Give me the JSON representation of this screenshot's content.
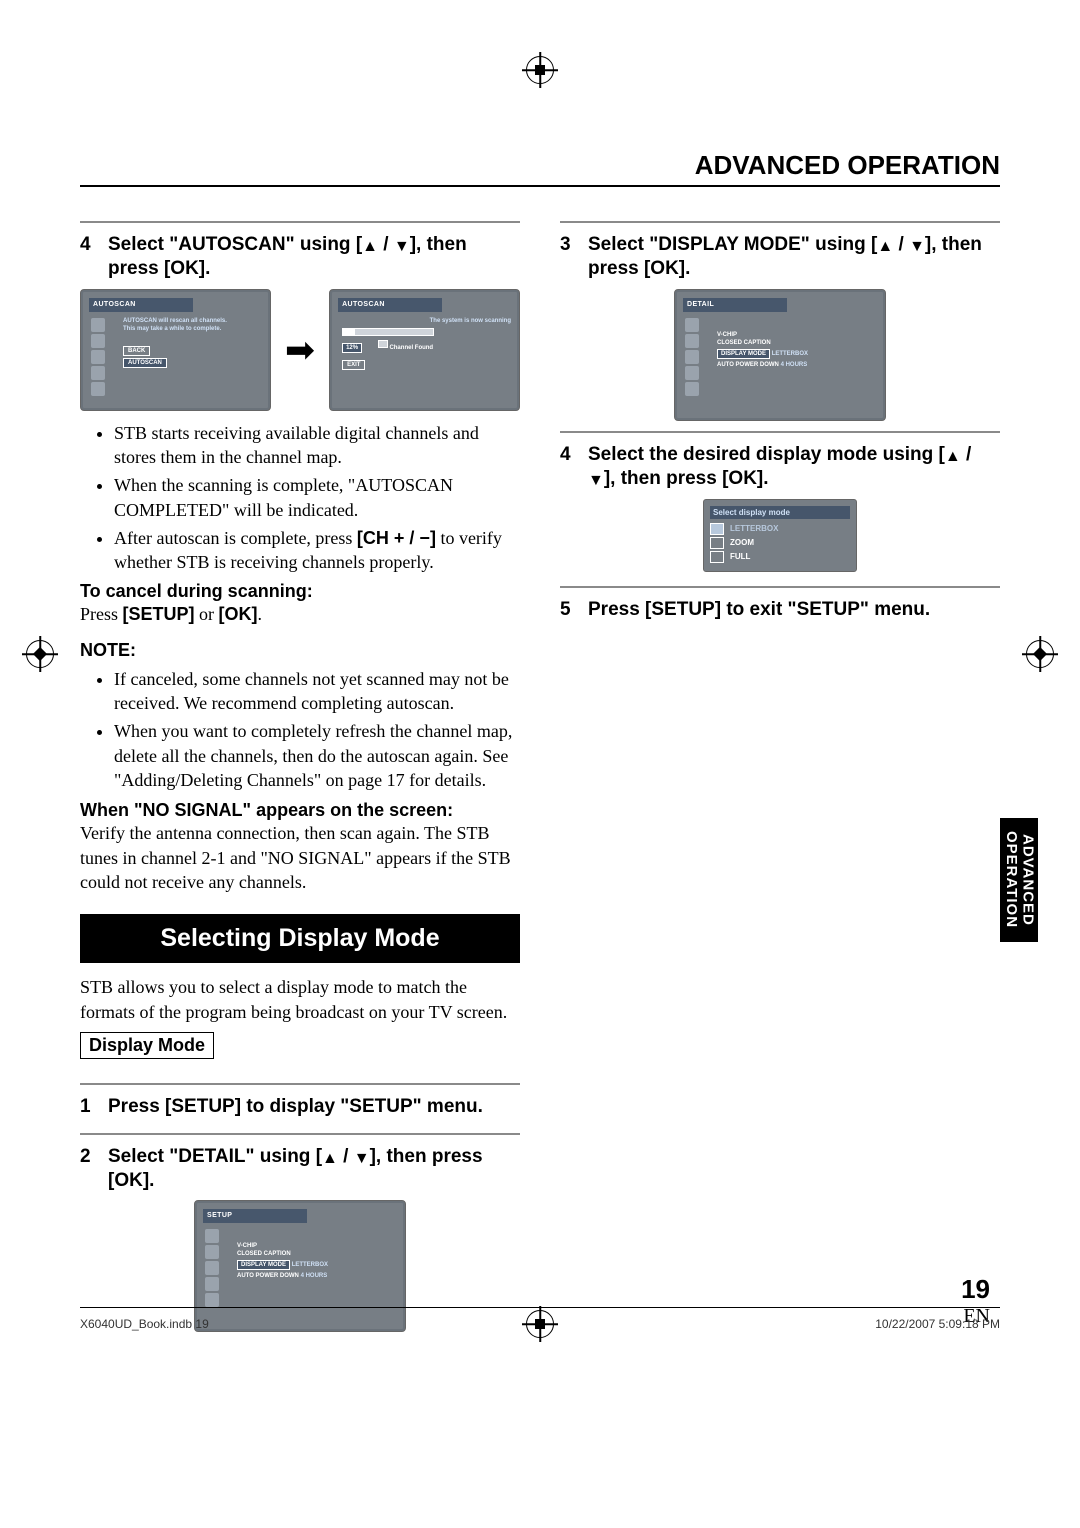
{
  "chapter_title": "ADVANCED OPERATION",
  "side_tab": "ADVANCED OPERATION",
  "left": {
    "step4": {
      "num": "4",
      "text_a": "Select \"AUTOSCAN\" using [",
      "text_b": "], then press [OK]."
    },
    "tvA": {
      "titlebar": "AUTOSCAN",
      "line1": "AUTOSCAN will rescan all channels.",
      "line2": "This may take a while to complete.",
      "btn_back": "BACK",
      "btn_scan": "AUTOSCAN"
    },
    "tvB": {
      "titlebar": "AUTOSCAN",
      "status": "The system is now scanning",
      "pct": "12%",
      "found": "Channel Found",
      "exit": "EXIT"
    },
    "bul1": "STB starts receiving available digital channels and stores them in the channel map.",
    "bul2": "When the scanning is complete, \"AUTOSCAN COMPLETED\" will be indicated.",
    "bul3a": "After autoscan is complete, press ",
    "bul3b": "[CH + / −]",
    "bul3c": " to verify whether STB is receiving channels properly.",
    "cancel_h": "To cancel during scanning:",
    "cancel_a": "Press ",
    "cancel_b": "[SETUP]",
    "cancel_c": " or ",
    "cancel_d": "[OK]",
    "cancel_e": ".",
    "note_h": "NOTE:",
    "note1": "If canceled, some channels not yet scanned may not be received. We recommend completing autoscan.",
    "note2": "When you want to completely refresh the channel map, delete all the channels, then do the autoscan again. See \"Adding/Deleting Channels\" on page 17 for details.",
    "nosig_h": "When \"NO SIGNAL\" appears on the screen:",
    "nosig_b": "Verify the antenna connection, then scan again. The STB tunes in channel 2-1 and \"NO SIGNAL\" appears if the STB could not receive any channels.",
    "band": "Selecting Display Mode",
    "band_intro": "STB allows you to select a display mode to match the formats of the program being broadcast on your TV screen.",
    "box": "Display Mode",
    "s1": {
      "num": "1",
      "text": "Press [SETUP] to display \"SETUP\" menu."
    },
    "s2": {
      "num": "2",
      "text_a": "Select \"DETAIL\" using [",
      "text_b": "], then press [OK]."
    },
    "tvSetup": {
      "titlebar": "SETUP",
      "r1": "V-CHIP",
      "r2": "CLOSED CAPTION",
      "r3": "DISPLAY MODE",
      "r3v": "LETTERBOX",
      "r4": "AUTO POWER DOWN",
      "r4v": "4 HOURS"
    }
  },
  "right": {
    "s3": {
      "num": "3",
      "text_a": "Select \"DISPLAY MODE\" using [",
      "text_b": "], then press [OK]."
    },
    "tvDetail": {
      "titlebar": "DETAIL",
      "r1": "V-CHIP",
      "r2": "CLOSED CAPTION",
      "r3": "DISPLAY MODE",
      "r3v": "LETTERBOX",
      "r4": "AUTO POWER DOWN",
      "r4v": "4 HOURS"
    },
    "s4": {
      "num": "4",
      "text_a": "Select the desired display mode using [",
      "text_b": "], then press [OK]."
    },
    "popup": {
      "title": "Select display mode",
      "o1": "LETTERBOX",
      "o2": "ZOOM",
      "o3": "FULL"
    },
    "s5": {
      "num": "5",
      "text": "Press [SETUP] to exit \"SETUP\" menu."
    }
  },
  "page": {
    "num": "19",
    "lang": "EN"
  },
  "footer": {
    "left": "X6040UD_Book.indb   19",
    "right": "10/22/2007   5:09:18 PM"
  }
}
